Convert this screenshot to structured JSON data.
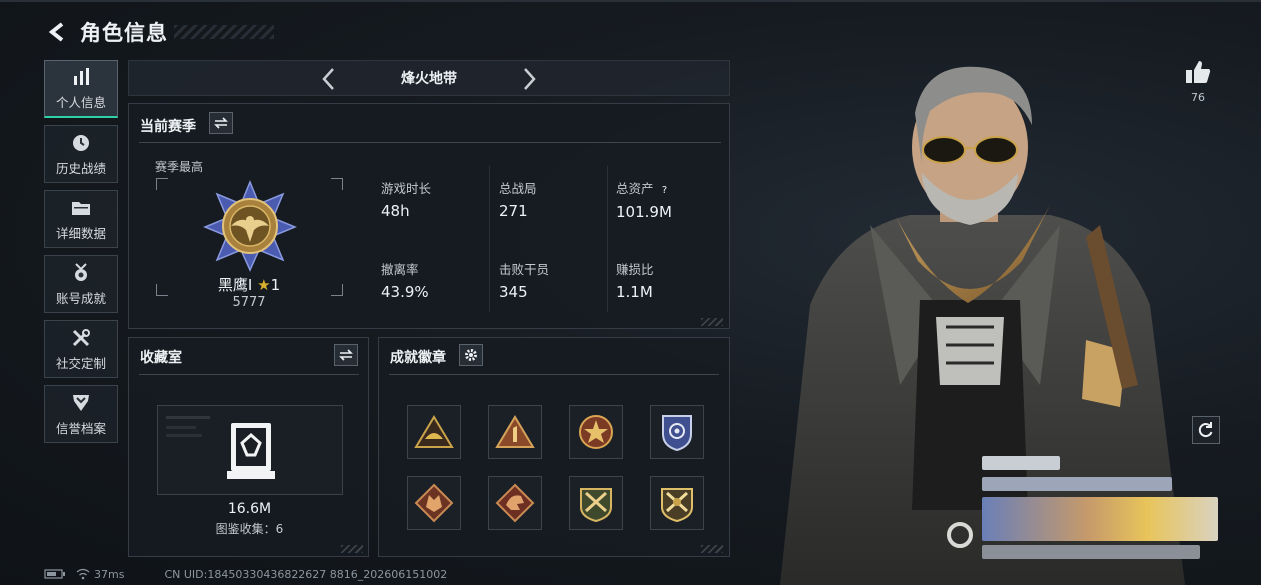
{
  "header": {
    "title": "角色信息",
    "back_icon": "back-arrow-icon"
  },
  "sidebar": {
    "items": [
      {
        "label": "个人信息",
        "icon": "bar-chart-icon",
        "active": true
      },
      {
        "label": "历史战绩",
        "icon": "clock-icon",
        "active": false
      },
      {
        "label": "详细数据",
        "icon": "folder-icon",
        "active": false
      },
      {
        "label": "账号成就",
        "icon": "medal-icon",
        "active": false
      },
      {
        "label": "社交定制",
        "icon": "tools-icon",
        "active": false
      },
      {
        "label": "信誉档案",
        "icon": "shield-icon",
        "active": false
      }
    ]
  },
  "season_selector": {
    "name": "烽火地带"
  },
  "current_season": {
    "title": "当前赛季",
    "best_label": "赛季最高",
    "rank_name": "黑鹰I",
    "rank_stars": "1",
    "rank_score": "5777",
    "stats": [
      {
        "label": "游戏时长",
        "value": "48h"
      },
      {
        "label": "总战局",
        "value": "271"
      },
      {
        "label": "总资产",
        "value": "101.9M",
        "help": "?"
      },
      {
        "label": "撤离率",
        "value": "43.9%"
      },
      {
        "label": "击败干员",
        "value": "345"
      },
      {
        "label": "赚损比",
        "value": "1.1M"
      }
    ]
  },
  "collection": {
    "title": "收藏室",
    "value": "16.6M",
    "count_label": "图鉴收集：6"
  },
  "achievements": {
    "title": "成就徽章",
    "badges": [
      "pyramid-helmet-badge-icon",
      "pyramid-one-badge-icon",
      "star-emblem-badge-icon",
      "police-shield-badge-icon",
      "wolf-head-badge-icon",
      "dragon-head-badge-icon",
      "crossed-rifles-badge-icon",
      "crossed-rifles-gold-badge-icon"
    ]
  },
  "profile": {
    "likes": "76"
  },
  "footer": {
    "ping": "37ms",
    "uid": "CN UID:18450330436822627 8816_202606151002"
  },
  "colors": {
    "accent": "#2fd1a6",
    "gold": "#c9a24a",
    "panel_border": "#353c45"
  }
}
